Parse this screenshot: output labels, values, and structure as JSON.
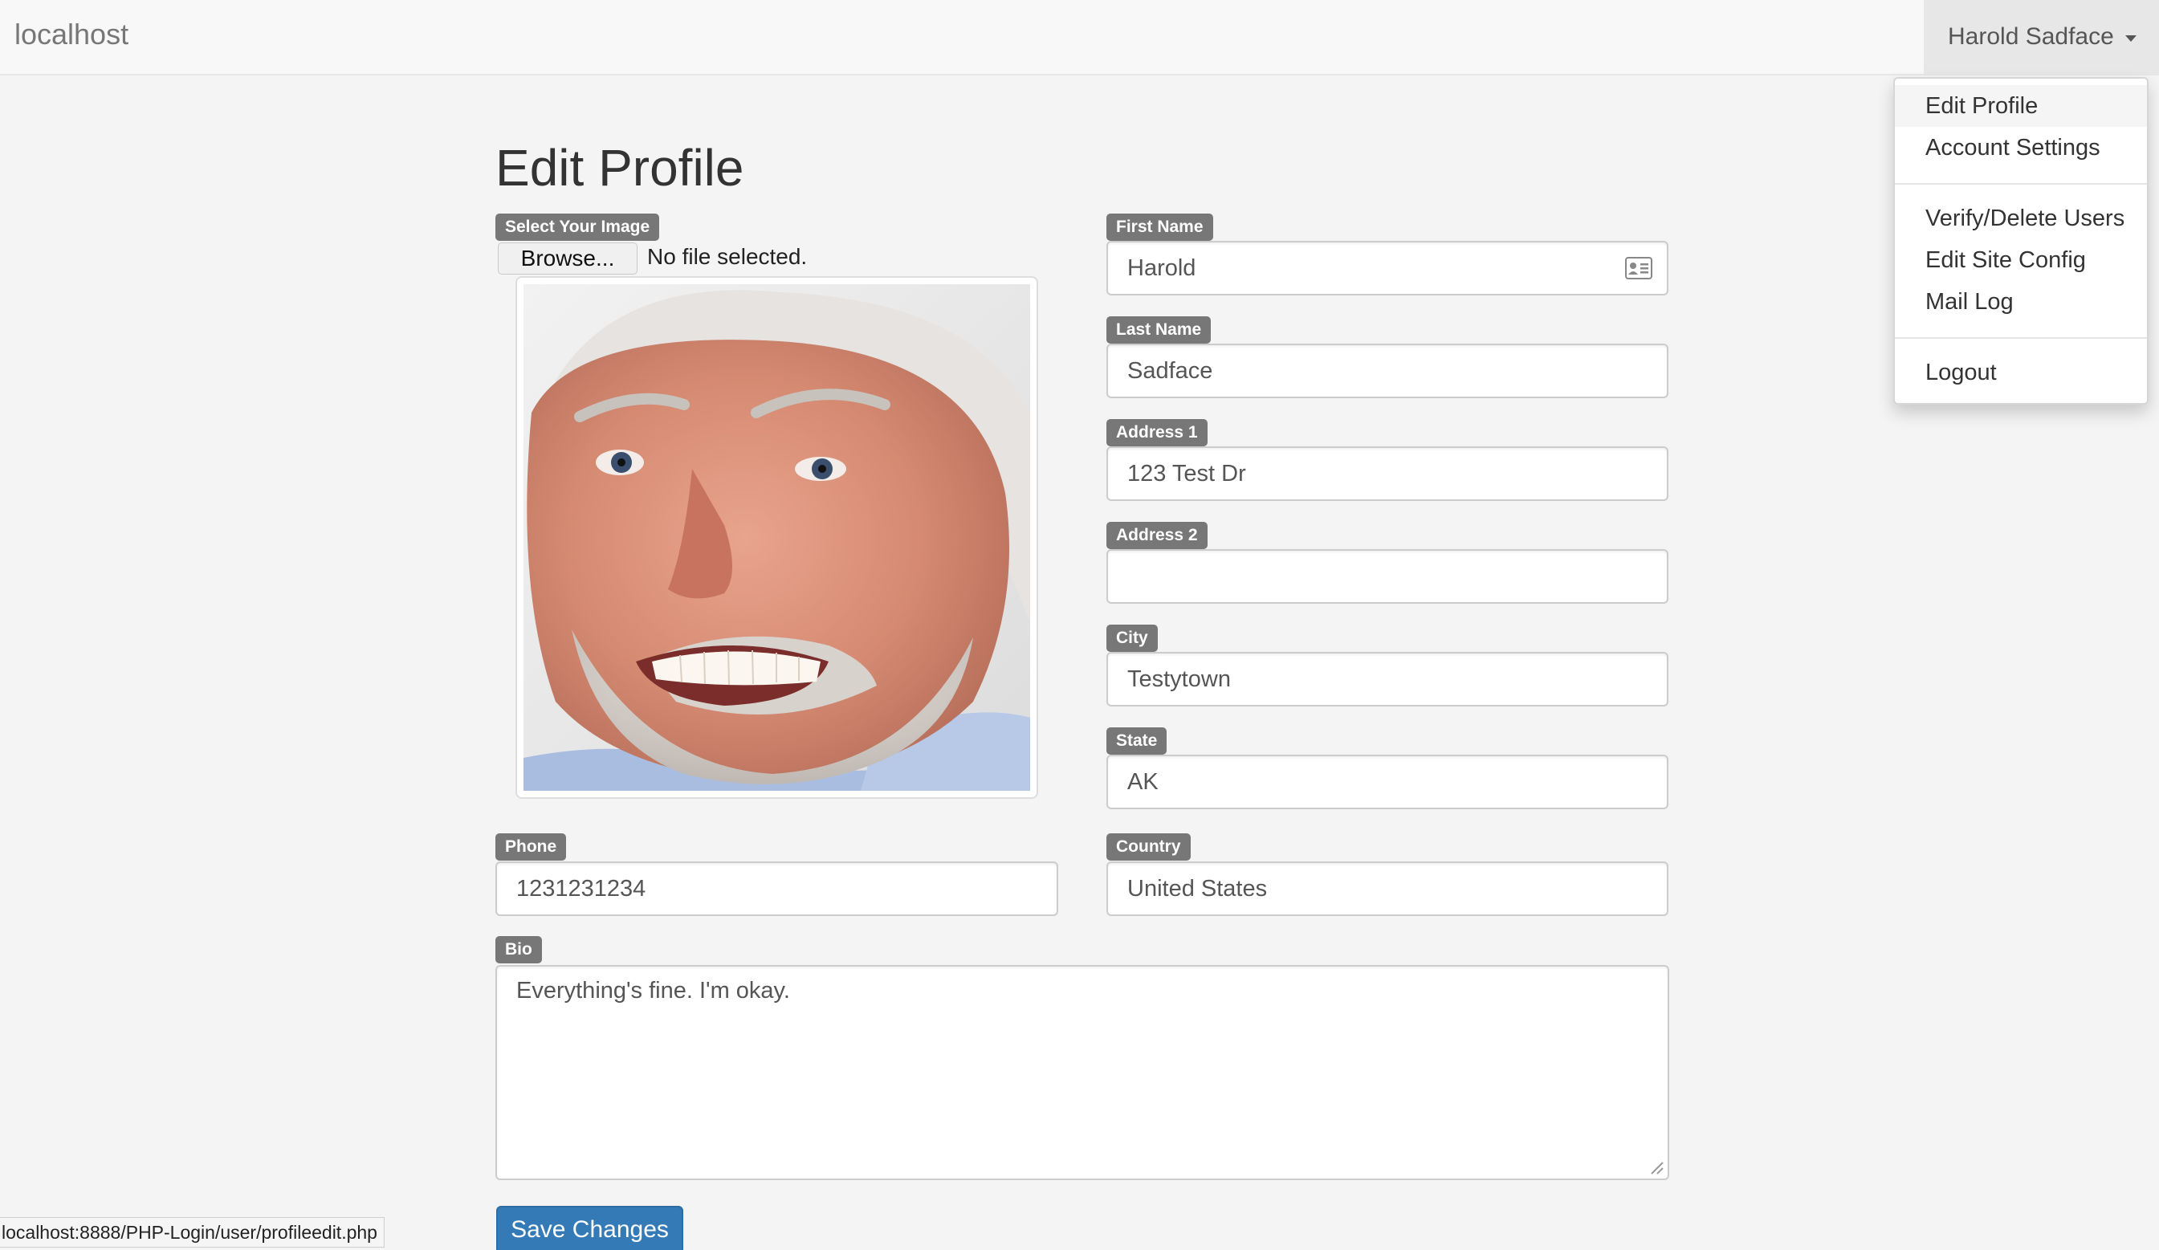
{
  "navbar": {
    "brand": "localhost",
    "user_name": "Harold Sadface"
  },
  "user_menu": {
    "items": [
      {
        "label": "Edit Profile"
      },
      {
        "label": "Account Settings"
      },
      {
        "label": "Verify/Delete Users"
      },
      {
        "label": "Edit Site Config"
      },
      {
        "label": "Mail Log"
      },
      {
        "label": "Logout"
      }
    ]
  },
  "page": {
    "title": "Edit Profile"
  },
  "image_upload": {
    "label": "Select Your Image",
    "browse_label": "Browse...",
    "file_status": "No file selected."
  },
  "form": {
    "first_name": {
      "label": "First Name",
      "value": "Harold"
    },
    "last_name": {
      "label": "Last Name",
      "value": "Sadface"
    },
    "address1": {
      "label": "Address 1",
      "value": "123 Test Dr"
    },
    "address2": {
      "label": "Address 2",
      "value": ""
    },
    "city": {
      "label": "City",
      "value": "Testytown"
    },
    "state": {
      "label": "State",
      "value": "AK"
    },
    "phone": {
      "label": "Phone",
      "value": "1231231234"
    },
    "country": {
      "label": "Country",
      "value": "United States"
    },
    "bio": {
      "label": "Bio",
      "value": "Everything's fine. I'm okay."
    }
  },
  "actions": {
    "save_label": "Save Changes"
  },
  "status_bar": {
    "url": "localhost:8888/PHP-Login/user/profileedit.php"
  },
  "colors": {
    "label_bg": "#777777",
    "primary": "#337ab7",
    "navbar_bg": "#f8f8f8",
    "page_bg": "#f4f4f4"
  }
}
